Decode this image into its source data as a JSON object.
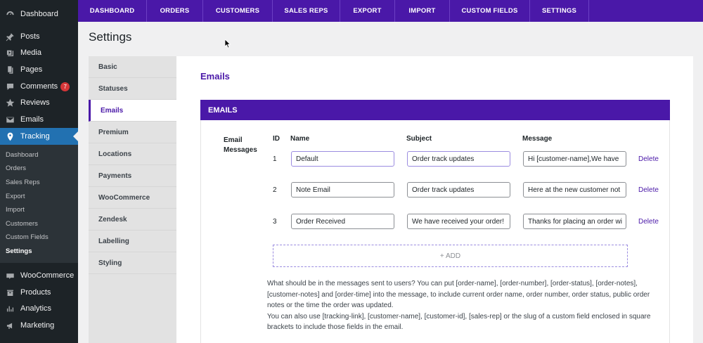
{
  "wp_menu": [
    {
      "label": "Dashboard",
      "icon": "dashboard-icon"
    },
    {
      "label": "Posts",
      "icon": "pin-icon"
    },
    {
      "label": "Media",
      "icon": "media-icon"
    },
    {
      "label": "Pages",
      "icon": "pages-icon"
    },
    {
      "label": "Comments",
      "icon": "comments-icon",
      "badge": "7"
    },
    {
      "label": "Reviews",
      "icon": "star-icon"
    },
    {
      "label": "Emails",
      "icon": "mail-icon"
    },
    {
      "label": "Tracking",
      "icon": "location-icon"
    }
  ],
  "wp_submenu": [
    "Dashboard",
    "Orders",
    "Sales Reps",
    "Export",
    "Import",
    "Customers",
    "Custom Fields",
    "Settings"
  ],
  "wp_menu_bottom": [
    {
      "label": "WooCommerce",
      "icon": "woocommerce-icon"
    },
    {
      "label": "Products",
      "icon": "products-icon"
    },
    {
      "label": "Analytics",
      "icon": "analytics-icon"
    },
    {
      "label": "Marketing",
      "icon": "megaphone-icon"
    }
  ],
  "top_nav": [
    "DASHBOARD",
    "ORDERS",
    "CUSTOMERS",
    "SALES REPS",
    "EXPORT",
    "IMPORT",
    "CUSTOM FIELDS",
    "SETTINGS"
  ],
  "page_title": "Settings",
  "settings_tabs": [
    "Basic",
    "Statuses",
    "Emails",
    "Premium",
    "Locations",
    "Payments",
    "WooCommerce",
    "Zendesk",
    "Labelling",
    "Styling"
  ],
  "active_tab": "Emails",
  "section_heading": "Emails",
  "panel_title": "EMAILS",
  "field_label": "Email Messages",
  "table_headers": {
    "id": "ID",
    "name": "Name",
    "subject": "Subject",
    "message": "Message"
  },
  "rows": [
    {
      "id": "1",
      "name": "Default",
      "subject": "Order track updates",
      "message": "Hi [customer-name],We have ",
      "delete": "Delete"
    },
    {
      "id": "2",
      "name": "Note Email",
      "subject": "Order track updates",
      "message": "Here at the new customer not",
      "delete": "Delete"
    },
    {
      "id": "3",
      "name": "Order Received",
      "subject": "We have received your order!",
      "message": "Thanks for placing an order wi",
      "delete": "Delete"
    }
  ],
  "add_label": "+ ADD",
  "help_text_1": "What should be in the messages sent to users? You can put [order-name], [order-number], [order-status], [order-notes], [customer-notes] and [order-time] into the message, to include current order name, order number, order status, public order notes or the time the order was updated.",
  "help_text_2": "You can also use [tracking-link], [customer-name], [customer-id], [sales-rep] or the slug of a custom field enclosed in square brackets to include those fields in the email.",
  "colors": {
    "brand": "#4a18a8",
    "wp_sidebar": "#1d2327",
    "wp_active": "#2271b1",
    "badge": "#d63638"
  }
}
